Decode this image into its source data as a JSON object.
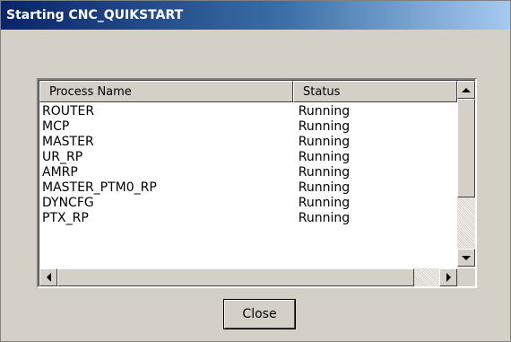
{
  "window": {
    "title": "Starting CNC_QUIKSTART"
  },
  "list": {
    "columns": [
      "Process Name",
      "Status"
    ],
    "rows": [
      {
        "name": "ROUTER",
        "status": "Running"
      },
      {
        "name": "MCP",
        "status": "Running"
      },
      {
        "name": "MASTER",
        "status": "Running"
      },
      {
        "name": "UR_RP",
        "status": "Running"
      },
      {
        "name": "AMRP",
        "status": "Running"
      },
      {
        "name": "MASTER_PTM0_RP",
        "status": "Running"
      },
      {
        "name": "DYNCFG",
        "status": "Running"
      },
      {
        "name": "PTX_RP",
        "status": "Running"
      }
    ]
  },
  "buttons": {
    "close_label": "Close"
  },
  "icons": {
    "scroll_up": "arrow-up-icon",
    "scroll_down": "arrow-down-icon",
    "scroll_left": "arrow-left-icon",
    "scroll_right": "arrow-right-icon"
  },
  "colors": {
    "titlebar_start": "#0a246a",
    "titlebar_end": "#a6caf0",
    "dialog_background": "#d4d0c8"
  }
}
